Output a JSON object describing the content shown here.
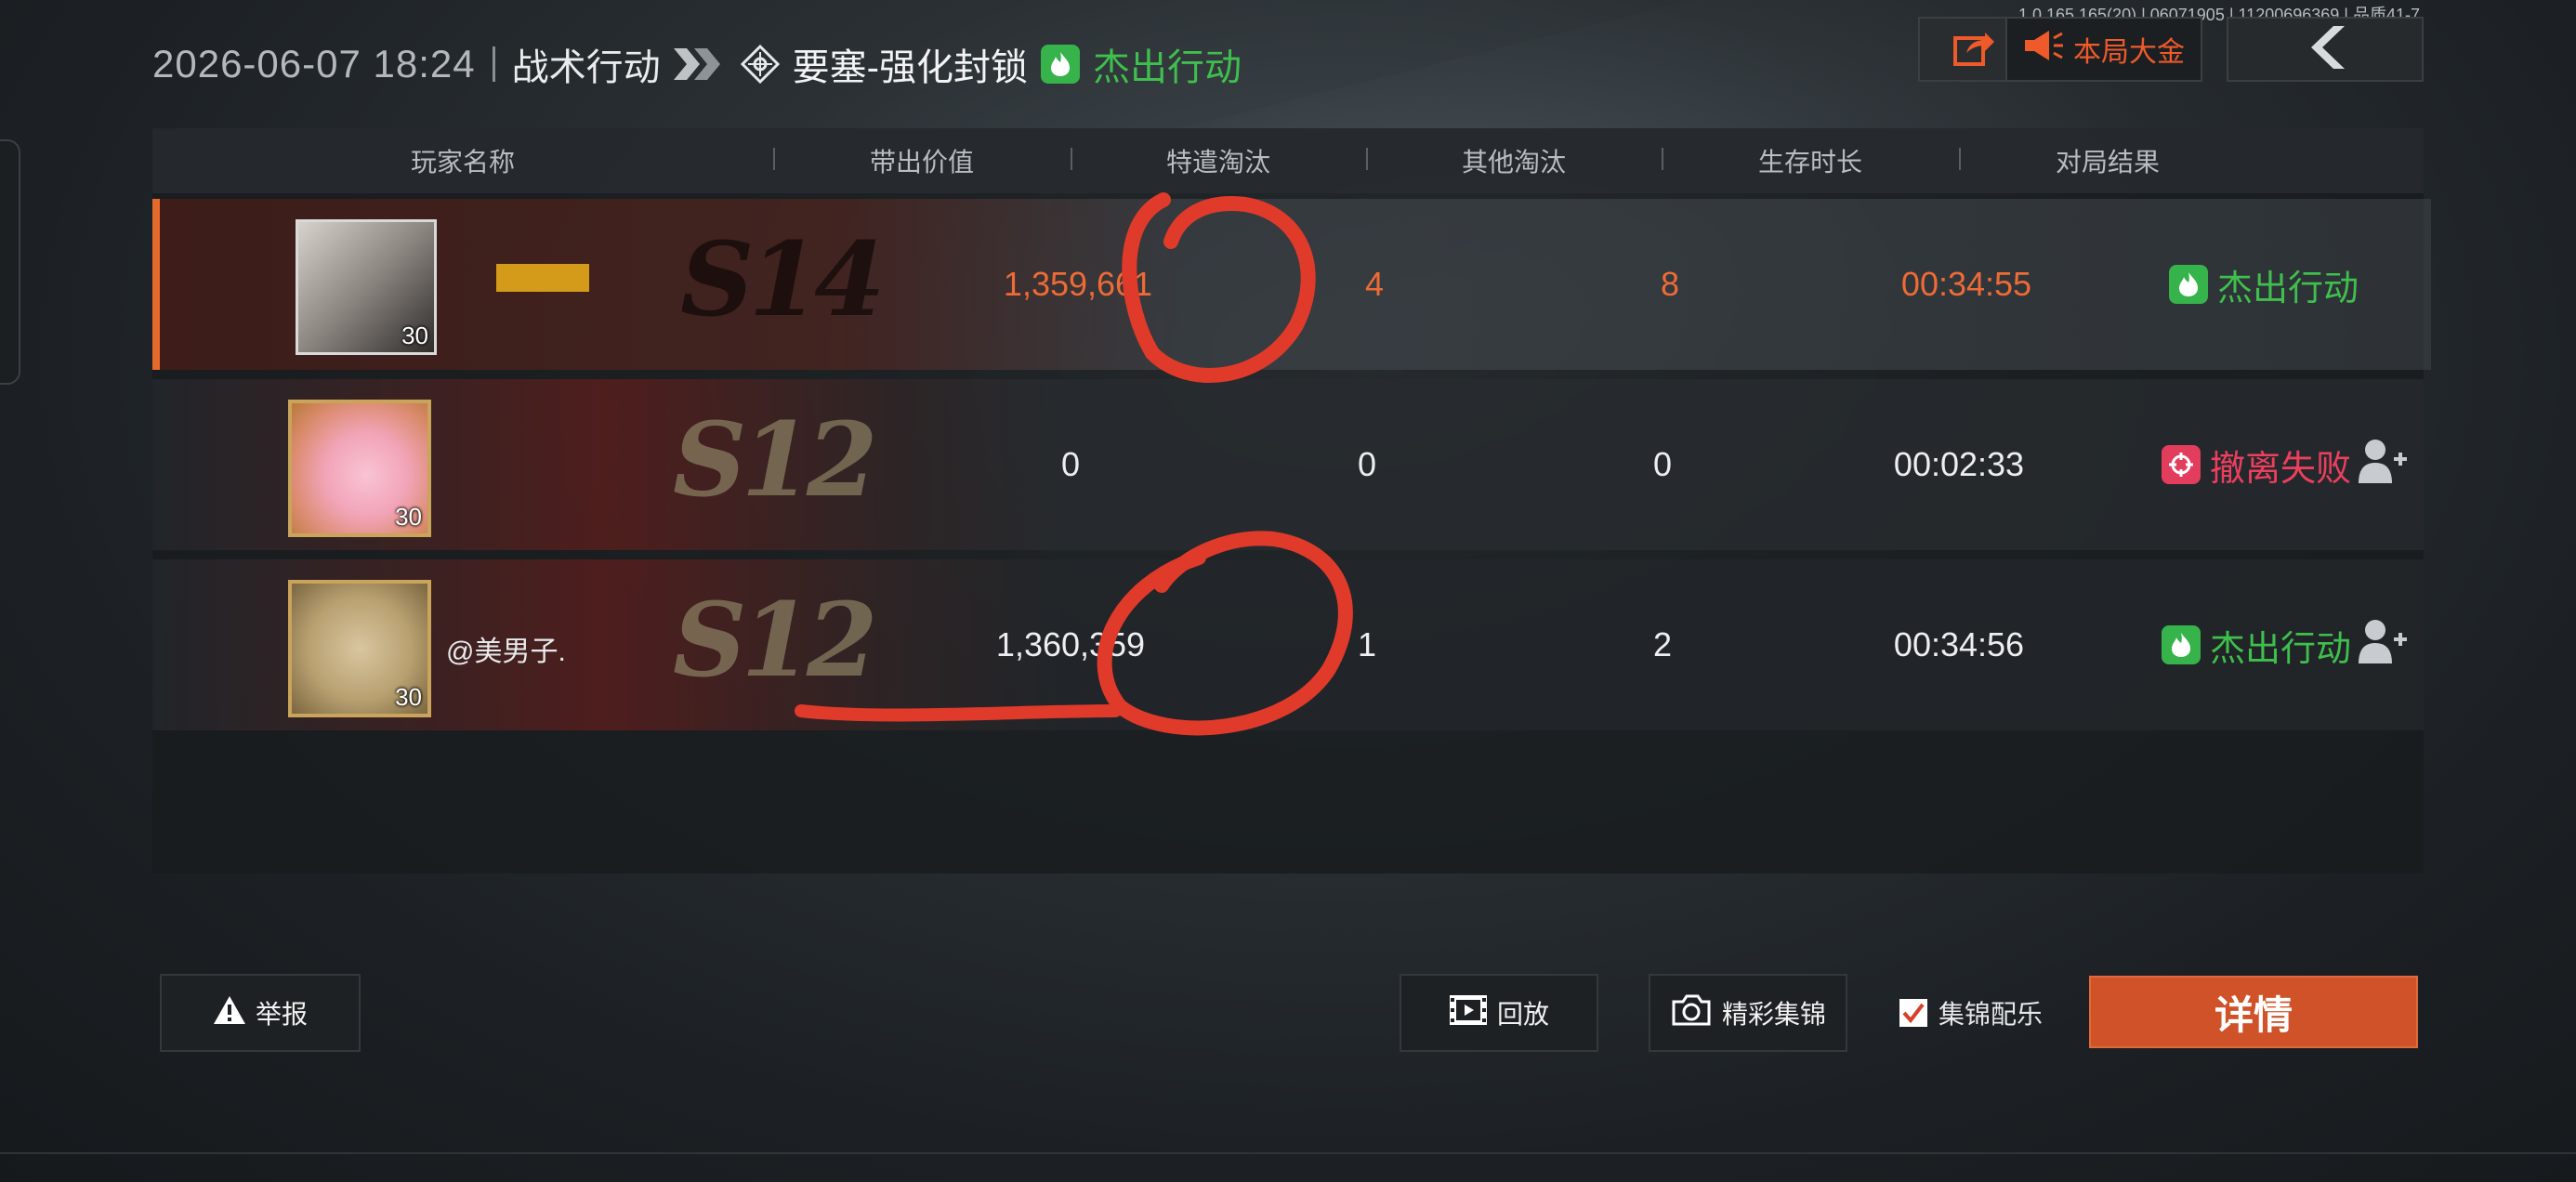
{
  "version_text": "1.0.165.165(20) | 06071905 | 11200696369 | 品质41-7",
  "header": {
    "datetime": "2026-06-07 18:24",
    "mode": "战术行动",
    "map": "要塞-强化封锁",
    "result": "杰出行动"
  },
  "top_buttons": {
    "share_icon": "share-icon",
    "bigmoney_label": "本局大金",
    "back_icon": "back-chevron-icon"
  },
  "table": {
    "headers": [
      "玩家名称",
      "带出价值",
      "特遣淘汰",
      "其他淘汰",
      "生存时长",
      "对局结果"
    ],
    "rows": [
      {
        "level": "30",
        "season": "S14",
        "name": "",
        "value": "1,359,661",
        "special_kills": "4",
        "other_kills": "8",
        "survival": "00:34:55",
        "result": "杰出行动",
        "result_color": "#3fbf4d"
      },
      {
        "level": "30",
        "season": "S12",
        "name": "",
        "value": "0",
        "special_kills": "0",
        "other_kills": "0",
        "survival": "00:02:33",
        "result": "撤离失败",
        "result_color": "#ec3f5e"
      },
      {
        "level": "30",
        "season": "S12",
        "name": "@美男子.",
        "value": "1,360,359",
        "special_kills": "1",
        "other_kills": "2",
        "survival": "00:34:56",
        "result": "杰出行动",
        "result_color": "#3fbf4d"
      }
    ]
  },
  "bottom": {
    "report_label": "举报",
    "replay_label": "回放",
    "highlights_label": "精彩集锦",
    "music_label": "集锦配乐",
    "music_checked": true,
    "detail_label": "详情"
  },
  "colors": {
    "accent_orange": "#ee6b35",
    "success_green": "#3fbf4d",
    "fail_red": "#ec3f5e",
    "annotation_red": "#e03a2a"
  }
}
